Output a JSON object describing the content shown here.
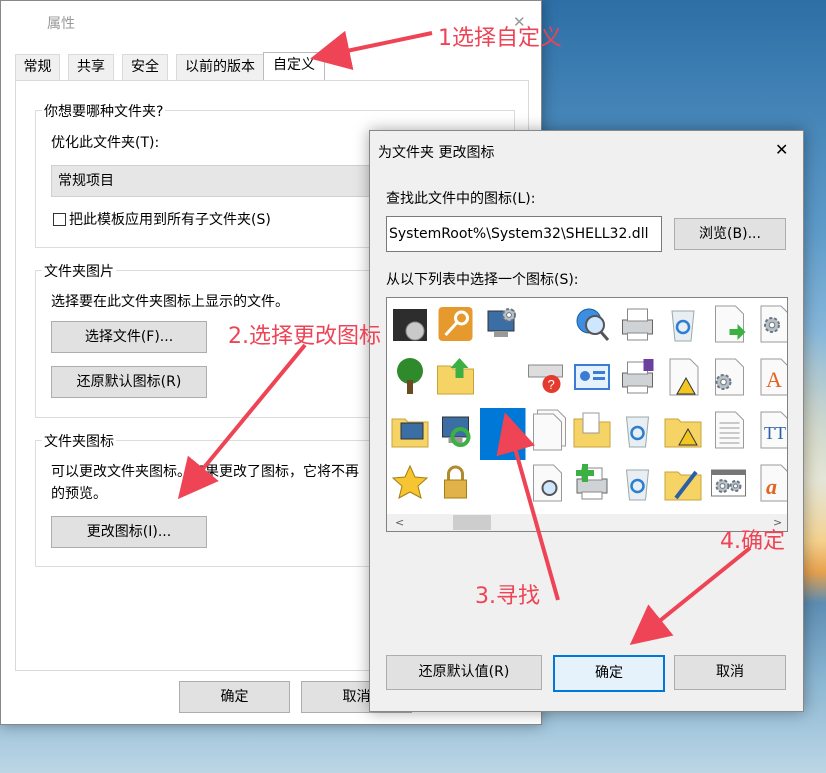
{
  "props_window": {
    "title": "属性",
    "close": "✕",
    "tabs": [
      "常规",
      "共享",
      "安全",
      "以前的版本",
      "自定义"
    ],
    "group1": {
      "title": "你想要哪种文件夹?",
      "optimize_label": "优化此文件夹(T):",
      "optimize_value": "常规项目",
      "apply_sub_label": "把此模板应用到所有子文件夹(S)"
    },
    "group2": {
      "title": "文件夹图片",
      "desc": "选择要在此文件夹图标上显示的文件。",
      "choose_btn": "选择文件(F)...",
      "restore_btn": "还原默认图标(R)"
    },
    "group3": {
      "title": "文件夹图标",
      "desc1": "可以更改文件夹图标。如果更改了图标，它将不再",
      "desc2": "的预览。",
      "change_btn": "更改图标(I)..."
    },
    "ok": "确定",
    "cancel": "取消"
  },
  "icon_dialog": {
    "title": "为文件夹  更改图标",
    "close": "✕",
    "find_label": "查找此文件中的图标(L):",
    "file_value": "SystemRoot%\\System32\\SHELL32.dll",
    "browse": "浏览(B)...",
    "list_label": "从以下列表中选择一个图标(S):",
    "restore": "还原默认值(R)",
    "ok": "确定",
    "cancel": "取消",
    "icons": [
      [
        "cd-drive-icon",
        "key-icon",
        "computer-settings-icon",
        "blank",
        "search-globe-icon",
        "printer-icon",
        "recycle-bin-icon",
        "file-arrow-icon",
        "gear-file-icon"
      ],
      [
        "tree-icon",
        "folder-up-icon",
        "blank",
        "help-computer-icon",
        "presentation-icon",
        "printer-doc-icon",
        "warning-file-icon",
        "gear-doc-icon",
        "font-a-icon"
      ],
      [
        "folder-computer-icon",
        "network-refresh-icon",
        "selected",
        "copy-files-icon",
        "folder-doc-icon",
        "recycle-bin-icon",
        "warning-folder-icon",
        "text-doc-icon",
        "font-tt-icon"
      ],
      [
        "star-icon",
        "lock-icon",
        "blank",
        "search-doc-icon",
        "add-printer-icon",
        "recycle-bin-icon",
        "folder-pen-icon",
        "settings-window-icon",
        "font-italic-a-icon"
      ]
    ]
  },
  "annotations": {
    "step1": "1选择自定义",
    "step2": "2.选择更改图标",
    "step3": "3.寻找",
    "step4": "4.确定",
    "color": "#ee4455"
  }
}
